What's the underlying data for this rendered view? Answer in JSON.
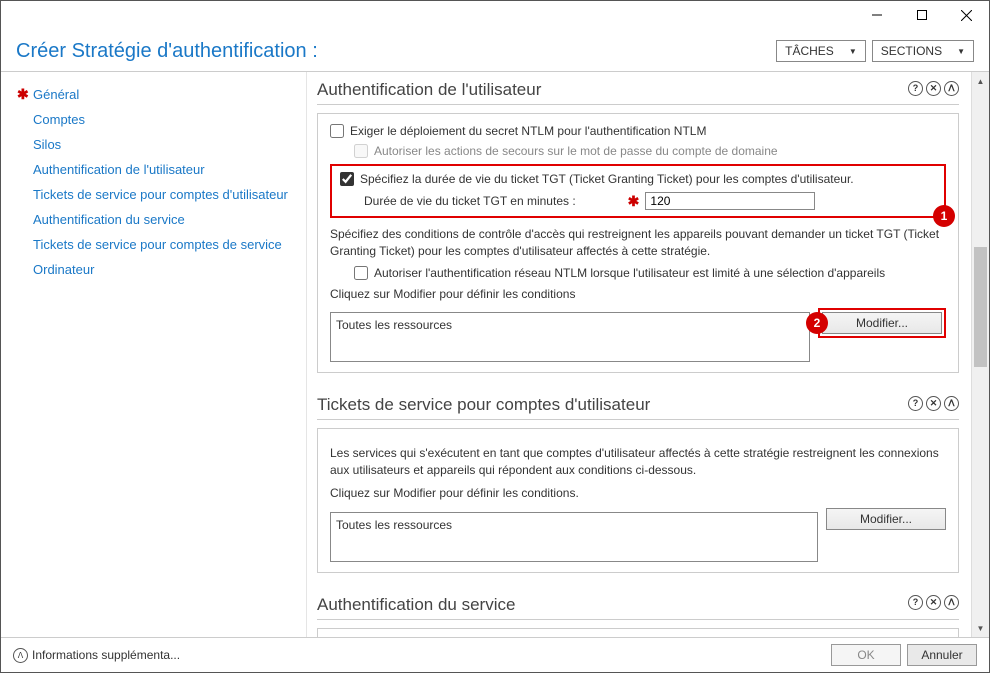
{
  "window": {
    "title": "Créer Stratégie d'authentification :",
    "tasks_label": "TÂCHES",
    "sections_label": "SECTIONS"
  },
  "sidebar": {
    "items": [
      {
        "label": "Général",
        "required": true
      },
      {
        "label": "Comptes",
        "required": false
      },
      {
        "label": "Silos",
        "required": false
      },
      {
        "label": "Authentification de l'utilisateur",
        "required": false
      },
      {
        "label": "Tickets de service pour comptes d'utilisateur",
        "required": false
      },
      {
        "label": "Authentification du service",
        "required": false
      },
      {
        "label": "Tickets de service pour comptes de service",
        "required": false
      },
      {
        "label": "Ordinateur",
        "required": false
      }
    ]
  },
  "sec_user_auth": {
    "title": "Authentification de l'utilisateur",
    "cb_ntlm": "Exiger le déploiement du secret NTLM pour l'authentification NTLM",
    "cb_recovery": "Autoriser les actions de secours sur le mot de passe du compte de domaine",
    "cb_tgt": "Spécifiez la durée de vie du ticket TGT (Ticket Granting Ticket) pour les comptes d'utilisateur.",
    "tgt_label": "Durée de vie du ticket TGT en minutes :",
    "tgt_value": "120",
    "badge1": "1",
    "para1": "Spécifiez des conditions de contrôle d'accès qui restreignent les appareils pouvant demander un ticket TGT (Ticket Granting Ticket) pour les comptes d'utilisateur affectés à cette stratégie.",
    "cb_limit": "Autoriser l'authentification réseau NTLM lorsque l'utilisateur est limité à une sélection d'appareils",
    "click_modify": "Cliquez sur Modifier pour définir les conditions",
    "cond_text": "Toutes les ressources",
    "modify_btn": "Modifier...",
    "badge2": "2"
  },
  "sec_tickets": {
    "title": "Tickets de service pour comptes d'utilisateur",
    "para": "Les services qui s'exécutent en tant que comptes d'utilisateur affectés à cette stratégie restreignent les connexions aux utilisateurs et appareils qui répondent aux conditions ci-dessous.",
    "click_modify": "Cliquez sur Modifier pour définir les conditions.",
    "cond_text": "Toutes les ressources",
    "modify_btn": "Modifier..."
  },
  "sec_service_auth": {
    "title": "Authentification du service"
  },
  "footer": {
    "info": "Informations supplémenta...",
    "ok": "OK",
    "cancel": "Annuler"
  }
}
